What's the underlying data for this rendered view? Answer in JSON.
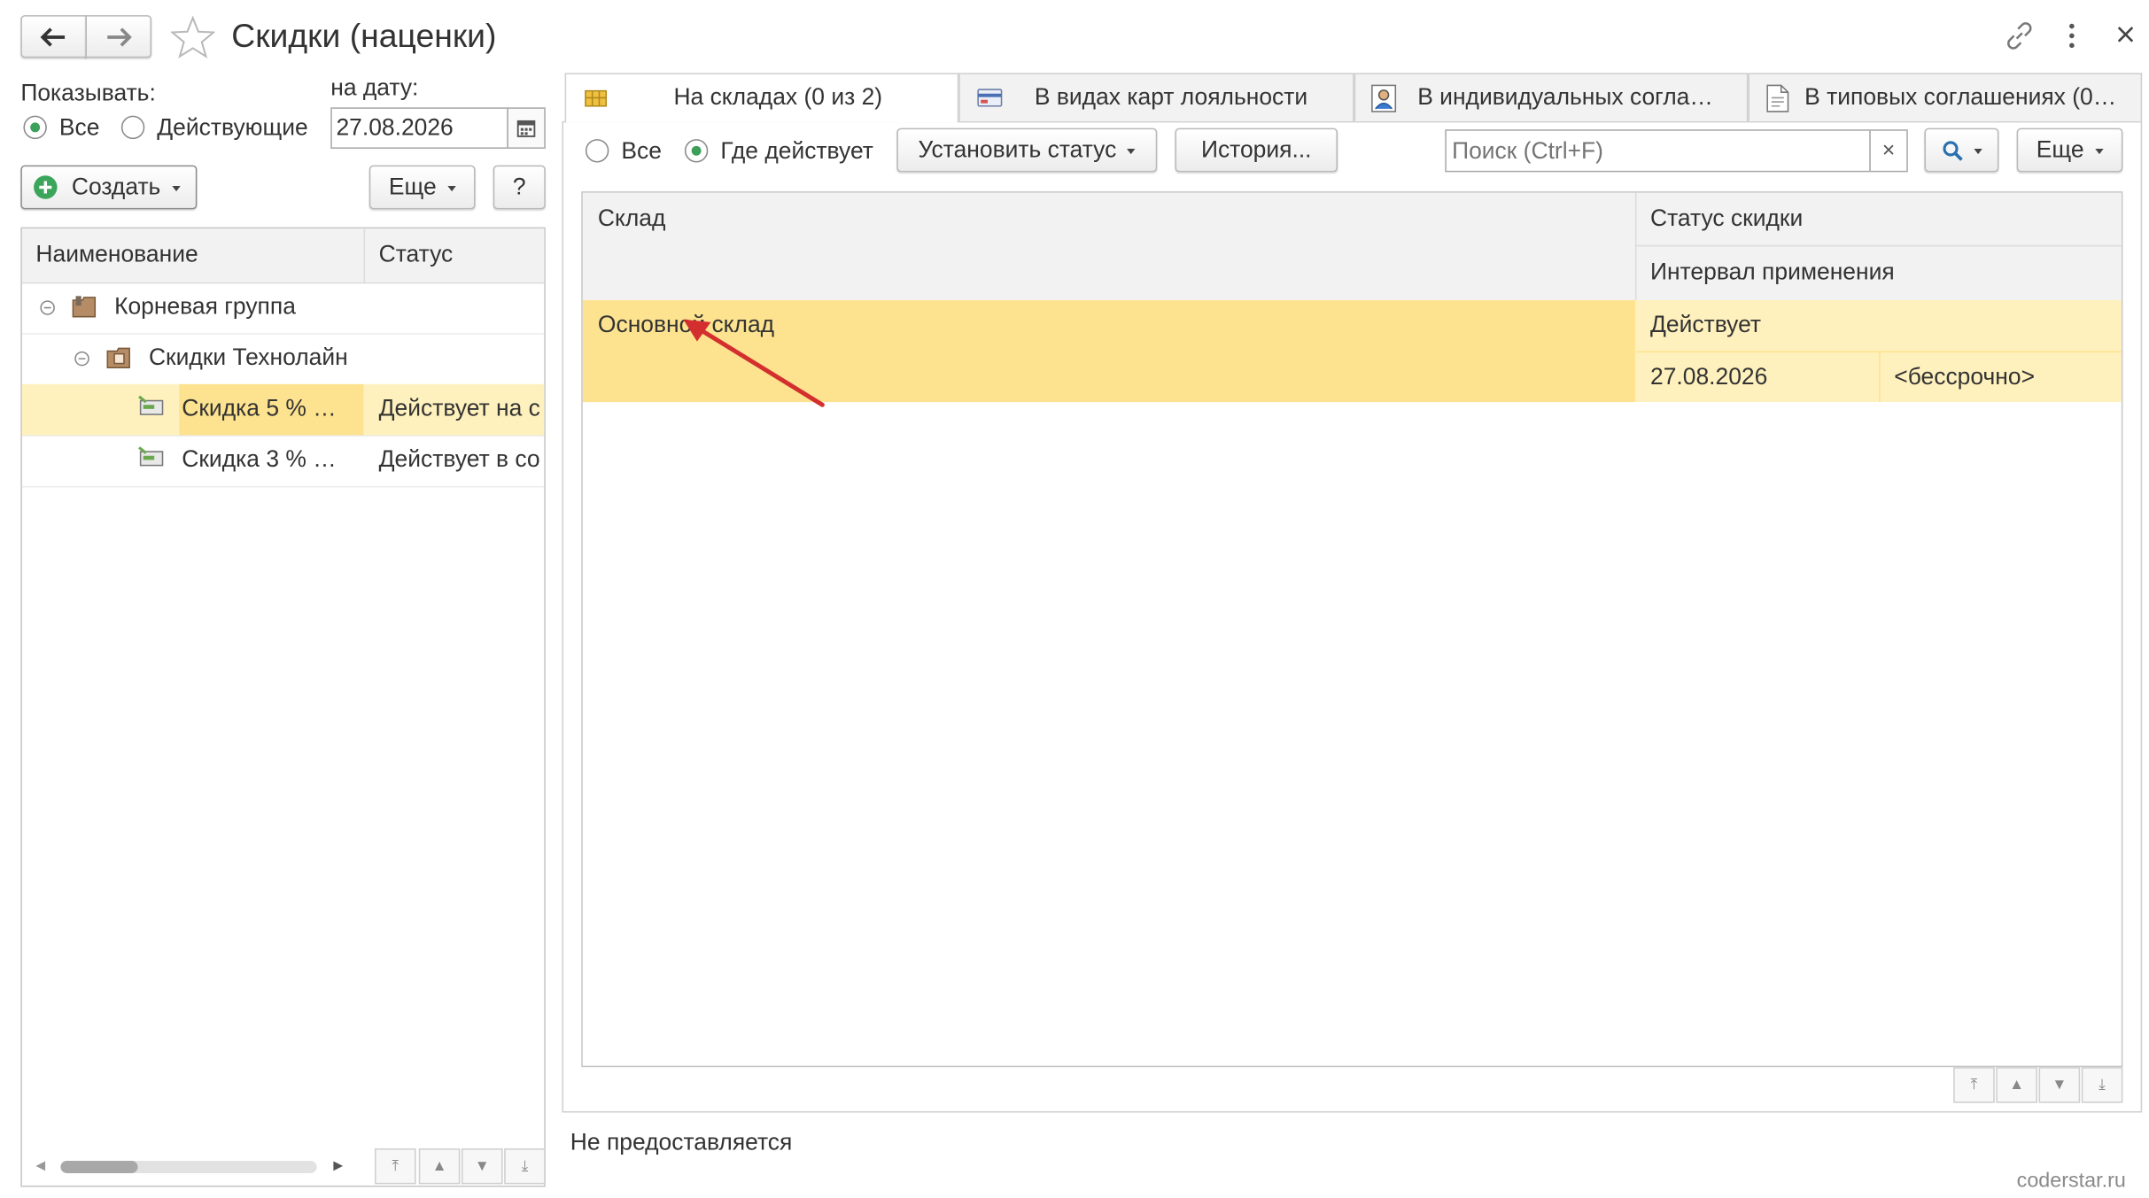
{
  "window": {
    "title": "Скидки (наценки)",
    "back_icon": "arrow-left-icon",
    "forward_icon": "arrow-right-icon",
    "favorite_icon": "star-icon",
    "link_icon": "link-icon",
    "menu_icon": "more-vertical-icon",
    "close_icon": "close-icon"
  },
  "left": {
    "show_label": "Показывать:",
    "radio_all": "Все",
    "radio_active": "Действующие",
    "date_label": "на дату:",
    "date_value": "27.08.2026",
    "create_label": "Создать",
    "more_label": "Еще",
    "help_label": "?",
    "columns": [
      "Наименование",
      "Статус"
    ],
    "tree": [
      {
        "name": "Корневая группа",
        "status": ""
      },
      {
        "name": "Скидки Технолайн",
        "status": ""
      },
      {
        "name": "Скидка 5 % …",
        "status": "Действует на с"
      },
      {
        "name": "Скидка 3 % …",
        "status": "Действует в со"
      }
    ]
  },
  "tabs": [
    {
      "label": "На складах (0 из 2)",
      "icon": "warehouse-icon"
    },
    {
      "label": "В видах карт лояльности",
      "icon": "loyalty-card-icon"
    },
    {
      "label": "В индивидуальных согла…",
      "icon": "person-document-icon"
    },
    {
      "label": "В типовых соглашениях (0…",
      "icon": "document-icon"
    }
  ],
  "toolbar": {
    "radio_all": "Все",
    "radio_where": "Где действует",
    "set_status": "Установить статус",
    "history": "История...",
    "search_placeholder": "Поиск (Ctrl+F)",
    "search_clear": "×",
    "more": "Еще"
  },
  "table": {
    "col_warehouse": "Склад",
    "col_status": "Статус скидки",
    "col_interval": "Интервал применения",
    "rows": [
      {
        "warehouse": "Основной склад",
        "status": "Действует",
        "date": "27.08.2026",
        "interval": "<бессрочно>"
      }
    ]
  },
  "footer_text": "Не предоставляется",
  "watermark": "coderstar.ru",
  "colors": {
    "selection": "#fde38f",
    "selection_light": "#fff1bd",
    "header_bg": "#f2f2f2",
    "arrow": "#d32f2f",
    "radio_dot": "#3c9f5a",
    "create_plus": "#3aa55b"
  }
}
